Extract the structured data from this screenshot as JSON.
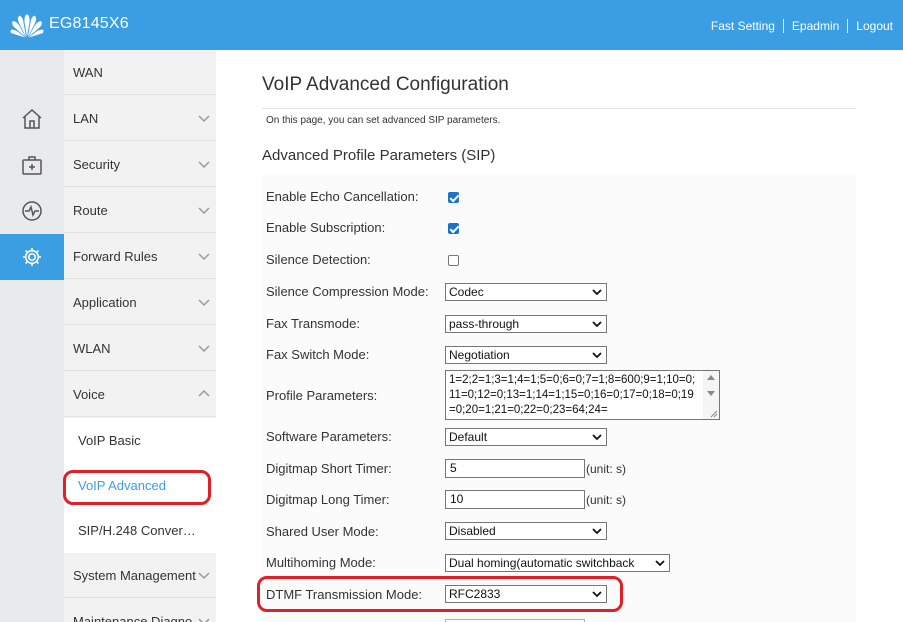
{
  "header": {
    "brand": "EG8145X6",
    "links": {
      "fast_setting": "Fast Setting",
      "user": "Epadmin",
      "logout": "Logout"
    },
    "bg_color": "#3b9ee2"
  },
  "rail": {
    "items": [
      {
        "icon": "home-icon"
      },
      {
        "icon": "toolbox-icon"
      },
      {
        "icon": "activity-icon"
      },
      {
        "icon": "gear-icon",
        "active": true
      }
    ]
  },
  "subnav": {
    "items": [
      {
        "label": "WAN"
      },
      {
        "label": "LAN"
      },
      {
        "label": "Security"
      },
      {
        "label": "Route"
      },
      {
        "label": "Forward Rules"
      },
      {
        "label": "Application"
      },
      {
        "label": "WLAN"
      },
      {
        "label": "Voice",
        "expanded": true
      },
      {
        "label": "System Management"
      },
      {
        "label": "Maintenance Diagno"
      }
    ],
    "voice_children": [
      {
        "label": "VoIP Basic"
      },
      {
        "label": "VoIP Advanced",
        "active": true
      },
      {
        "label": "SIP/H.248 Conversi..."
      }
    ]
  },
  "main": {
    "title": "VoIP Advanced Configuration",
    "description": "On this page, you can set advanced SIP parameters.",
    "section_title": "Advanced Profile Parameters (SIP)",
    "fields": {
      "echo_cancellation": {
        "label": "Enable Echo Cancellation:",
        "checked": true
      },
      "subscription": {
        "label": "Enable Subscription:",
        "checked": true
      },
      "silence_detection": {
        "label": "Silence Detection:",
        "checked": false
      },
      "silence_compression_mode": {
        "label": "Silence Compression Mode:",
        "value": "Codec"
      },
      "fax_transmode": {
        "label": "Fax Transmode:",
        "value": "pass-through"
      },
      "fax_switch_mode": {
        "label": "Fax Switch Mode:",
        "value": "Negotiation"
      },
      "profile_parameters": {
        "label": "Profile Parameters:",
        "value": "1=2;2=1;3=1;4=1;5=0;6=0;7=1;8=600;9=1;10=0;11=0;12=0;13=1;14=1;15=0;16=0;17=0;18=0;19=0;20=1;21=0;22=0;23=64;24="
      },
      "software_parameters": {
        "label": "Software Parameters:",
        "value": "Default"
      },
      "digitmap_short_timer": {
        "label": "Digitmap Short Timer:",
        "value": "5",
        "unit": "(unit: s)"
      },
      "digitmap_long_timer": {
        "label": "Digitmap Long Timer:",
        "value": "10",
        "unit": "(unit: s)"
      },
      "shared_user_mode": {
        "label": "Shared User Mode:",
        "value": "Disabled"
      },
      "multihoming_mode": {
        "label": "Multihoming Mode:",
        "value": "Dual homing(automatic switchback"
      },
      "dtmf_transmission_mode": {
        "label": "DTMF Transmission Mode:",
        "value": "RFC2833"
      }
    }
  },
  "colors": {
    "accent": "#3b9ee2",
    "highlight": "#e02024",
    "checkbox": "#1a73c8"
  }
}
